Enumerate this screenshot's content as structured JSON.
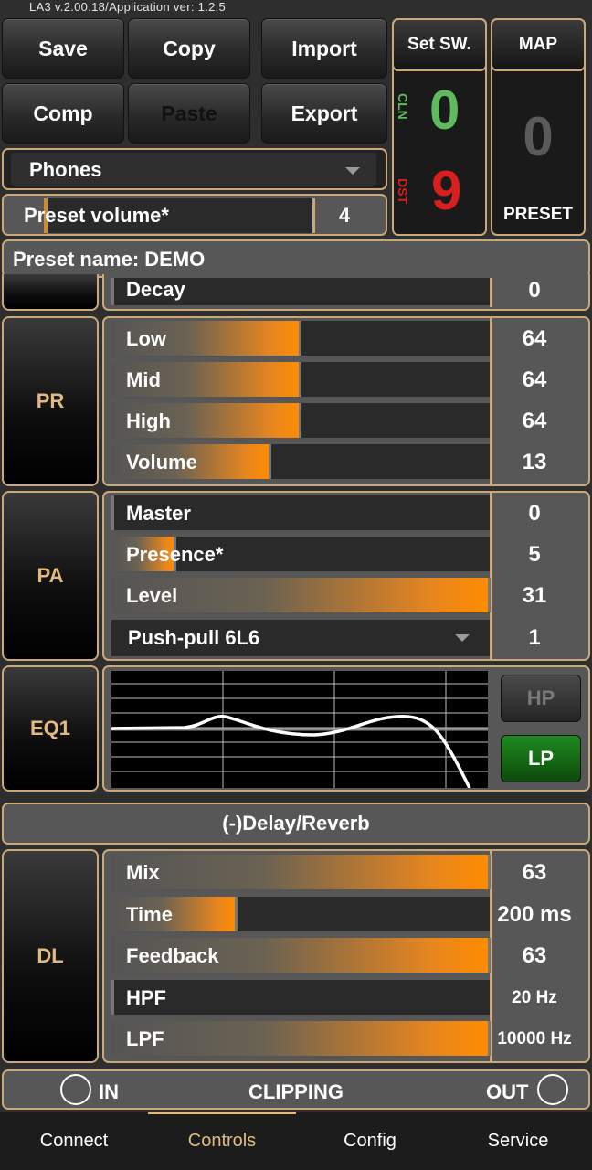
{
  "version": "LA3 v.2.00.18/Application ver: 1.2.5",
  "toolbar": {
    "save": "Save",
    "copy": "Copy",
    "import": "Import",
    "comp": "Comp",
    "paste": "Paste",
    "export": "Export",
    "set_sw": "Set SW.",
    "map": "MAP"
  },
  "switches": {
    "cln_label": "CLN",
    "cln_value": "0",
    "dst_label": "DST",
    "dst_value": "9"
  },
  "map_panel": {
    "value": "0",
    "label": "PRESET"
  },
  "output_select": "Phones",
  "preset_volume": {
    "label": "Preset volume*",
    "value": "4",
    "level": 0.02
  },
  "preset_name": "Preset name: DEMO",
  "decay": {
    "label": "Decay",
    "value": "0"
  },
  "pr": {
    "name": "PR",
    "rows": [
      {
        "label": "Low",
        "value": "64",
        "level": 0.5
      },
      {
        "label": "Mid",
        "value": "64",
        "level": 0.5
      },
      {
        "label": "High",
        "value": "64",
        "level": 0.5
      },
      {
        "label": "Volume",
        "value": "13",
        "level": 0.42
      }
    ]
  },
  "pa": {
    "name": "PA",
    "rows": [
      {
        "label": "Master",
        "value": "0",
        "level": 0.0
      },
      {
        "label": "Presence*",
        "value": "5",
        "level": 0.17
      },
      {
        "label": "Level",
        "value": "31",
        "level": 1.0
      }
    ],
    "type_select": "Push-pull 6L6",
    "type_value": "1"
  },
  "eq1": {
    "name": "EQ1",
    "hp": "HP",
    "lp": "LP"
  },
  "delay_header": "(-)Delay/Reverb",
  "dl": {
    "name": "DL",
    "rows": [
      {
        "label": "Mix",
        "value": "63",
        "level": 1.0
      },
      {
        "label": "Time",
        "value": "200 ms",
        "level": 0.33
      },
      {
        "label": "Feedback",
        "value": "63",
        "level": 1.0
      },
      {
        "label": "HPF",
        "value": "20 Hz",
        "level": 0.0
      },
      {
        "label": "LPF",
        "value": "10000 Hz",
        "level": 1.0
      }
    ]
  },
  "clipping": {
    "in": "IN",
    "title": "CLIPPING",
    "out": "OUT"
  },
  "tabs": [
    "Connect",
    "Controls",
    "Config",
    "Service"
  ],
  "active_tab": "Controls",
  "colors": {
    "accent": "#e2b97e",
    "cln": "#5fba5f",
    "dst": "#d91e1e",
    "fill": "#ff8c00",
    "lp": "#1a7a1a"
  }
}
